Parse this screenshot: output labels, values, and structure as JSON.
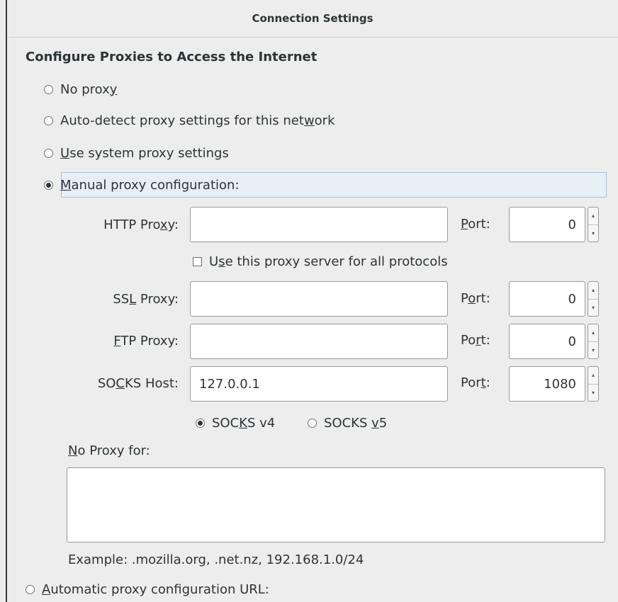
{
  "window": {
    "title": "Connection Settings"
  },
  "section_title": "Configure Proxies to Access the Internet",
  "proxy_modes": [
    {
      "pre": "No prox",
      "key": "y",
      "post": "",
      "selected": false
    },
    {
      "pre": "Auto-detect proxy settings for this net",
      "key": "w",
      "post": "ork",
      "selected": false
    },
    {
      "pre": "",
      "key": "U",
      "post": "se system proxy settings",
      "selected": false
    },
    {
      "pre": "",
      "key": "M",
      "post": "anual proxy configuration:",
      "selected": true
    }
  ],
  "manual": {
    "http": {
      "label_pre": "HTTP Pro",
      "label_key": "x",
      "label_post": "y:",
      "value": "",
      "port_pre": "",
      "port_key": "P",
      "port_post": "ort:",
      "port": "0"
    },
    "all_protocols": {
      "pre": "U",
      "key": "s",
      "post": "e this proxy server for all protocols",
      "checked": false
    },
    "ssl": {
      "label_pre": "SS",
      "label_key": "L",
      "label_post": " Proxy:",
      "value": "",
      "port_pre": "P",
      "port_key": "o",
      "port_post": "rt:",
      "port": "0"
    },
    "ftp": {
      "label_pre": "",
      "label_key": "F",
      "label_post": "TP Proxy:",
      "value": "",
      "port_pre": "Po",
      "port_key": "r",
      "port_post": "t:",
      "port": "0"
    },
    "socks": {
      "label_pre": "SO",
      "label_key": "C",
      "label_post": "KS Host:",
      "value": "127.0.0.1",
      "port_pre": "Por",
      "port_key": "t",
      "port_post": ":",
      "port": "1080"
    },
    "socks_v4": {
      "pre": "SOC",
      "key": "K",
      "post": "S v4",
      "selected": true
    },
    "socks_v5": {
      "pre": "SOCKS ",
      "key": "v",
      "post": "5",
      "selected": false
    }
  },
  "no_proxy": {
    "label_key": "N",
    "label_post": "o Proxy for:",
    "value": "",
    "example": "Example: .mozilla.org, .net.nz, 192.168.1.0/24"
  },
  "auto_url": {
    "pre": "",
    "key": "A",
    "post": "utomatic proxy configuration URL:",
    "selected": false
  },
  "icons": {
    "spinner_up": "▴",
    "spinner_down": "▾"
  }
}
